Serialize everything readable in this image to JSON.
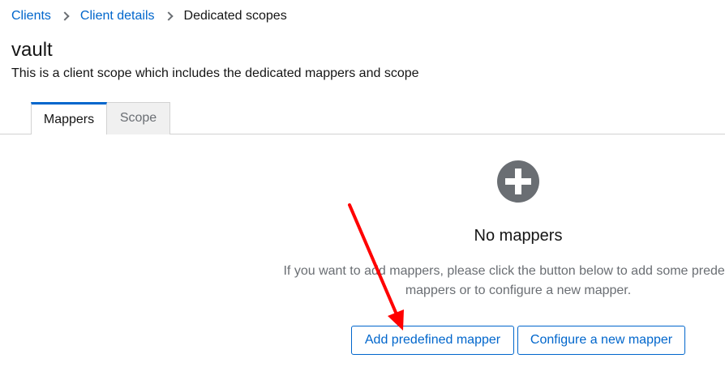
{
  "breadcrumb": {
    "items": [
      {
        "label": "Clients"
      },
      {
        "label": "Client details"
      }
    ],
    "current": "Dedicated scopes"
  },
  "header": {
    "title": "vault",
    "description": "This is a client scope which includes the dedicated mappers and scope"
  },
  "tabs": [
    {
      "label": "Mappers",
      "active": true
    },
    {
      "label": "Scope",
      "active": false
    }
  ],
  "empty_state": {
    "icon": "plus-circle-icon",
    "title": "No mappers",
    "body_line1": "If you want to add mappers, please click the button below to add some predefined",
    "body_line2": "mappers or to configure a new mapper."
  },
  "actions": {
    "add_predefined": "Add predefined mapper",
    "configure_new": "Configure a new mapper"
  },
  "colors": {
    "link": "#0066cc",
    "annotation_arrow": "#ff0000",
    "icon_gray": "#6a6e73"
  }
}
